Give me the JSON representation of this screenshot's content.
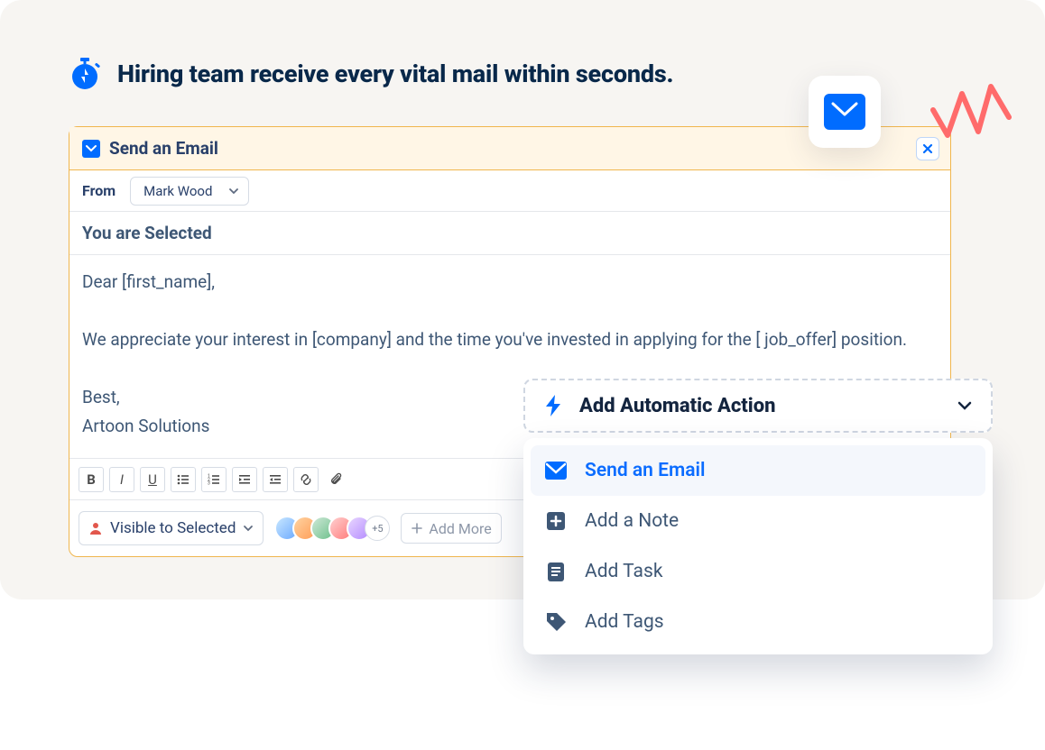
{
  "page": {
    "title": "Hiring team receive every vital mail within seconds."
  },
  "email_card": {
    "header_title": "Send an Email",
    "from_label": "From",
    "from_value": "Mark Wood",
    "subject": "You are Selected",
    "body_line1": "Dear [first_name],",
    "body_line2": "We appreciate your interest in [company] and the time you've invested in applying for the [ job_offer] position.",
    "body_line3": "Best,",
    "body_line4": "Artoon Solutions"
  },
  "visibility": {
    "label": "Visible to Selected",
    "more_count": "+5",
    "add_more_label": "Add More"
  },
  "auto_action": {
    "trigger_label": "Add Automatic Action",
    "items": {
      "0": {
        "label": "Send an Email"
      },
      "1": {
        "label": "Add a Note"
      },
      "2": {
        "label": "Add Task"
      },
      "3": {
        "label": "Add Tags"
      }
    }
  },
  "colors": {
    "primary": "#006CFF",
    "accent_border": "#F0B64E",
    "text_dark": "#14253F"
  }
}
